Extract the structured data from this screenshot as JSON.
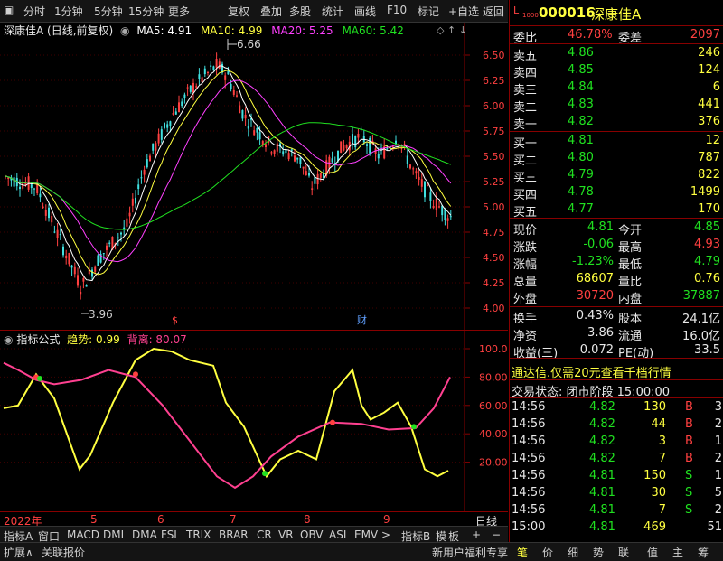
{
  "toolbar": {
    "items": [
      "分时",
      "1分钟",
      "5分钟",
      "15分钟",
      "更多",
      "复权",
      "叠加",
      "多股",
      "统计",
      "画线",
      "F10",
      "标记",
      "+自选",
      "返回"
    ]
  },
  "main_chart": {
    "title": "深康佳A (日线,前复权)",
    "ma": [
      {
        "label": "MA5: 4.91",
        "color": "#ffffff"
      },
      {
        "label": "MA10: 4.99",
        "color": "#ffff40"
      },
      {
        "label": "MA20: 5.25",
        "color": "#ff40ff"
      },
      {
        "label": "MA60: 5.42",
        "color": "#20e020"
      }
    ],
    "high_label": "6.66",
    "low_label": "3.96",
    "y_ticks": [
      "6.50",
      "6.25",
      "6.00",
      "5.75",
      "5.50",
      "5.25",
      "5.00",
      "4.75",
      "4.50",
      "4.25",
      "4.00"
    ],
    "markers": [
      "$",
      "财"
    ]
  },
  "indicator": {
    "title": "指标公式",
    "trend_label": "趋势: 0.99",
    "dev_label": "背离: 80.07",
    "y_ticks": [
      "100.0",
      "80.00",
      "60.00",
      "40.00",
      "20.00"
    ]
  },
  "x_axis": {
    "labels": [
      "2022年",
      "5",
      "6",
      "7",
      "8",
      "9"
    ],
    "period": "日线"
  },
  "indicator_tabs": [
    "指标A",
    "窗口",
    "MACD",
    "DMI",
    "DMA",
    "FSL",
    "TRIX",
    "BRAR",
    "CR",
    "VR",
    "OBV",
    "ASI",
    "EMV",
    ">",
    "指标B",
    "模",
    "板",
    "+",
    "−"
  ],
  "bottom_bar": {
    "left": [
      "扩展∧",
      "关联报价"
    ],
    "welfare": "新用户福利专享",
    "tabs": [
      "笔",
      "价",
      "细",
      "势",
      "联",
      "值",
      "主",
      "筹"
    ]
  },
  "quote": {
    "code": "000016",
    "name": "深康佳A",
    "weibi_label": "委比",
    "weibi": "46.78%",
    "weicha_label": "委差",
    "weicha": "2097",
    "asks": [
      {
        "label": "卖五",
        "price": "4.86",
        "vol": "246"
      },
      {
        "label": "卖四",
        "price": "4.85",
        "vol": "124"
      },
      {
        "label": "卖三",
        "price": "4.84",
        "vol": "6"
      },
      {
        "label": "卖二",
        "price": "4.83",
        "vol": "441"
      },
      {
        "label": "卖一",
        "price": "4.82",
        "vol": "376"
      }
    ],
    "bids": [
      {
        "label": "买一",
        "price": "4.81",
        "vol": "12"
      },
      {
        "label": "买二",
        "price": "4.80",
        "vol": "787"
      },
      {
        "label": "买三",
        "price": "4.79",
        "vol": "822"
      },
      {
        "label": "买四",
        "price": "4.78",
        "vol": "1499"
      },
      {
        "label": "买五",
        "price": "4.77",
        "vol": "170"
      }
    ],
    "stats": [
      {
        "l1": "现价",
        "v1": "4.81",
        "c1": "green",
        "l2": "今开",
        "v2": "4.85",
        "c2": "green"
      },
      {
        "l1": "涨跌",
        "v1": "-0.06",
        "c1": "green",
        "l2": "最高",
        "v2": "4.93",
        "c2": "red"
      },
      {
        "l1": "涨幅",
        "v1": "-1.23%",
        "c1": "green",
        "l2": "最低",
        "v2": "4.79",
        "c2": "green"
      },
      {
        "l1": "总量",
        "v1": "68607",
        "c1": "yellow",
        "l2": "量比",
        "v2": "0.76",
        "c2": "yellow"
      },
      {
        "l1": "外盘",
        "v1": "30720",
        "c1": "red",
        "l2": "内盘",
        "v2": "37887",
        "c2": "green"
      }
    ],
    "stats2": [
      {
        "l1": "换手",
        "v1": "0.43%",
        "l2": "股本",
        "v2": "24.1亿"
      },
      {
        "l1": "净资",
        "v1": "3.86",
        "l2": "流通",
        "v2": "16.0亿"
      },
      {
        "l1": "收益(三)",
        "v1": "0.072",
        "l2": "PE(动)",
        "v2": "33.5"
      }
    ],
    "promo": "通达信.仅需20元查看千档行情",
    "trade_status": "交易状态: 闭市阶段 15:00:00",
    "ticks": [
      {
        "time": "14:56",
        "price": "4.82",
        "vol": "130",
        "flag": "B",
        "n": "3"
      },
      {
        "time": "14:56",
        "price": "4.82",
        "vol": "44",
        "flag": "B",
        "n": "2"
      },
      {
        "time": "14:56",
        "price": "4.82",
        "vol": "3",
        "flag": "B",
        "n": "1"
      },
      {
        "time": "14:56",
        "price": "4.82",
        "vol": "7",
        "flag": "B",
        "n": "2"
      },
      {
        "time": "14:56",
        "price": "4.81",
        "vol": "150",
        "flag": "S",
        "n": "1"
      },
      {
        "time": "14:56",
        "price": "4.81",
        "vol": "30",
        "flag": "S",
        "n": "5"
      },
      {
        "time": "14:56",
        "price": "4.81",
        "vol": "7",
        "flag": "S",
        "n": "2"
      },
      {
        "time": "15:00",
        "price": "4.81",
        "vol": "469",
        "flag": "",
        "n": "51"
      }
    ]
  },
  "colors": {
    "up": "#ff4040",
    "down": "#40e0e0",
    "grid": "#800000",
    "ma5": "#ffffff",
    "ma10": "#ffff40",
    "ma20": "#ff40ff",
    "ma60": "#20e020",
    "trend": "#ffff40",
    "dev": "#ff4090"
  }
}
